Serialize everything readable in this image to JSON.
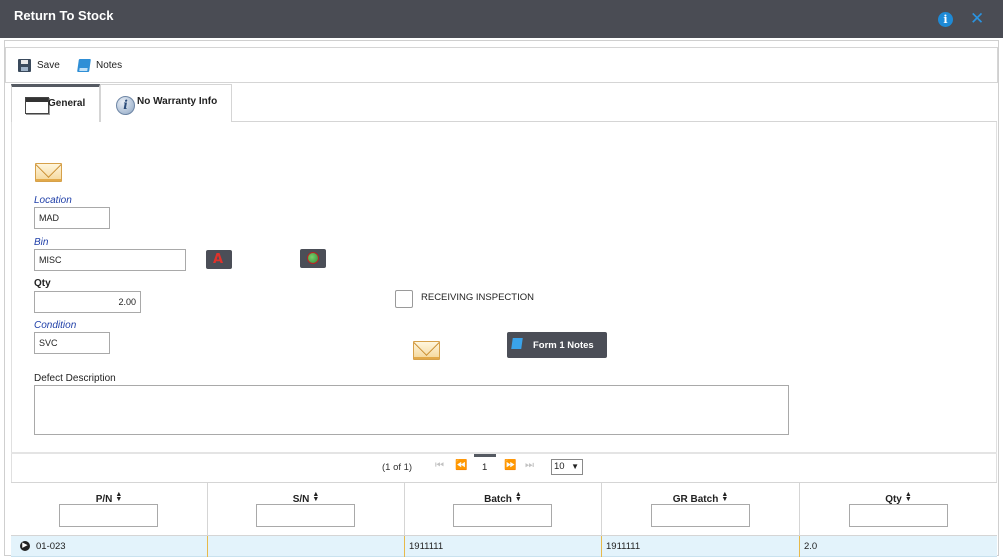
{
  "window": {
    "title": "Return To Stock",
    "info_icon": "info-icon",
    "close_icon": "close-icon"
  },
  "toolbar": {
    "save_label": "Save",
    "notes_label": "Notes"
  },
  "tabs": [
    {
      "label": "General",
      "icon": "window-icon",
      "active": true
    },
    {
      "label": "No Warranty Info",
      "icon": "info-icon",
      "active": false
    }
  ],
  "form": {
    "location": {
      "label": "Location",
      "value": "MAD"
    },
    "bin": {
      "label": "Bin",
      "value": "MISC"
    },
    "qty": {
      "label": "Qty",
      "value": "2.00"
    },
    "condition": {
      "label": "Condition",
      "value": "SVC"
    },
    "receiving_inspection": {
      "label": "RECEIVING INSPECTION",
      "checked": false
    },
    "form1_notes_label": "Form 1 Notes",
    "defect_description": {
      "label": "Defect Description",
      "value": ""
    }
  },
  "pager": {
    "summary": "(1 of 1)",
    "first": "⏮",
    "prev": "⏪",
    "current_page": "1",
    "next": "⏩",
    "last": "⏭",
    "page_size": "10"
  },
  "grid": {
    "columns": [
      "P/N",
      "S/N",
      "Batch",
      "GR Batch",
      "Qty"
    ],
    "rows": [
      {
        "pn": "01-023",
        "sn": "",
        "batch": "1911111",
        "gr_batch": "1911111",
        "qty": "2.0"
      }
    ]
  },
  "colors": {
    "titlebar": "#4a4c54",
    "accent_blue": "#1e8ad6",
    "link_label": "#1f3fa8",
    "row_highlight": "#e3f3fb"
  }
}
